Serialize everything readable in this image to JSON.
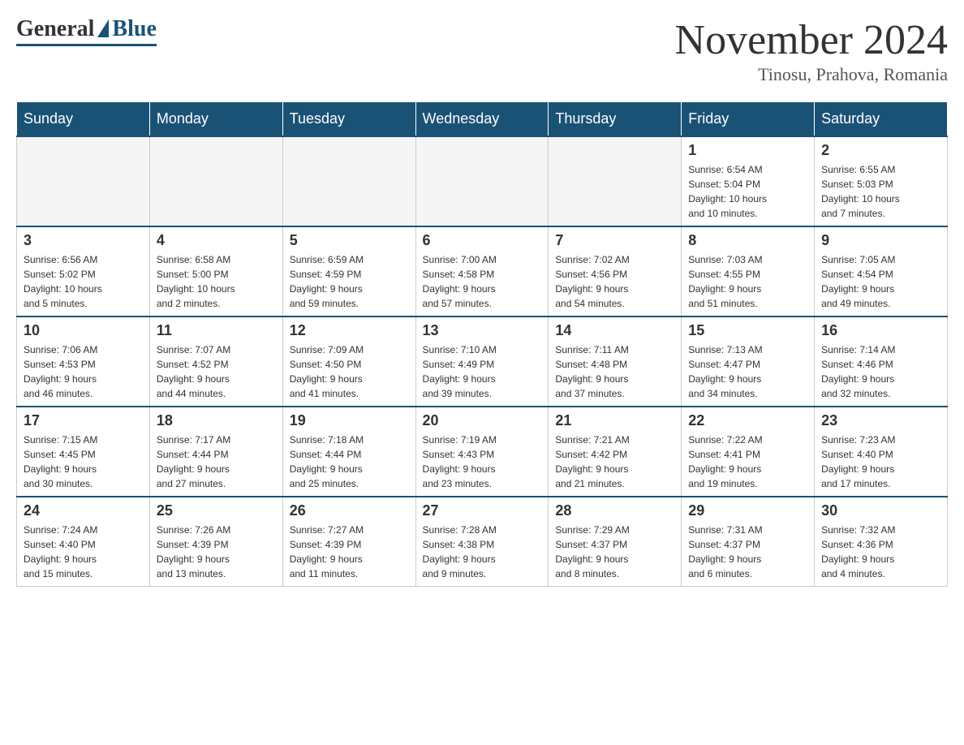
{
  "logo": {
    "general": "General",
    "blue": "Blue"
  },
  "title": {
    "month_year": "November 2024",
    "location": "Tinosu, Prahova, Romania"
  },
  "days_of_week": [
    "Sunday",
    "Monday",
    "Tuesday",
    "Wednesday",
    "Thursday",
    "Friday",
    "Saturday"
  ],
  "weeks": [
    [
      {
        "day": "",
        "info": ""
      },
      {
        "day": "",
        "info": ""
      },
      {
        "day": "",
        "info": ""
      },
      {
        "day": "",
        "info": ""
      },
      {
        "day": "",
        "info": ""
      },
      {
        "day": "1",
        "info": "Sunrise: 6:54 AM\nSunset: 5:04 PM\nDaylight: 10 hours\nand 10 minutes."
      },
      {
        "day": "2",
        "info": "Sunrise: 6:55 AM\nSunset: 5:03 PM\nDaylight: 10 hours\nand 7 minutes."
      }
    ],
    [
      {
        "day": "3",
        "info": "Sunrise: 6:56 AM\nSunset: 5:02 PM\nDaylight: 10 hours\nand 5 minutes."
      },
      {
        "day": "4",
        "info": "Sunrise: 6:58 AM\nSunset: 5:00 PM\nDaylight: 10 hours\nand 2 minutes."
      },
      {
        "day": "5",
        "info": "Sunrise: 6:59 AM\nSunset: 4:59 PM\nDaylight: 9 hours\nand 59 minutes."
      },
      {
        "day": "6",
        "info": "Sunrise: 7:00 AM\nSunset: 4:58 PM\nDaylight: 9 hours\nand 57 minutes."
      },
      {
        "day": "7",
        "info": "Sunrise: 7:02 AM\nSunset: 4:56 PM\nDaylight: 9 hours\nand 54 minutes."
      },
      {
        "day": "8",
        "info": "Sunrise: 7:03 AM\nSunset: 4:55 PM\nDaylight: 9 hours\nand 51 minutes."
      },
      {
        "day": "9",
        "info": "Sunrise: 7:05 AM\nSunset: 4:54 PM\nDaylight: 9 hours\nand 49 minutes."
      }
    ],
    [
      {
        "day": "10",
        "info": "Sunrise: 7:06 AM\nSunset: 4:53 PM\nDaylight: 9 hours\nand 46 minutes."
      },
      {
        "day": "11",
        "info": "Sunrise: 7:07 AM\nSunset: 4:52 PM\nDaylight: 9 hours\nand 44 minutes."
      },
      {
        "day": "12",
        "info": "Sunrise: 7:09 AM\nSunset: 4:50 PM\nDaylight: 9 hours\nand 41 minutes."
      },
      {
        "day": "13",
        "info": "Sunrise: 7:10 AM\nSunset: 4:49 PM\nDaylight: 9 hours\nand 39 minutes."
      },
      {
        "day": "14",
        "info": "Sunrise: 7:11 AM\nSunset: 4:48 PM\nDaylight: 9 hours\nand 37 minutes."
      },
      {
        "day": "15",
        "info": "Sunrise: 7:13 AM\nSunset: 4:47 PM\nDaylight: 9 hours\nand 34 minutes."
      },
      {
        "day": "16",
        "info": "Sunrise: 7:14 AM\nSunset: 4:46 PM\nDaylight: 9 hours\nand 32 minutes."
      }
    ],
    [
      {
        "day": "17",
        "info": "Sunrise: 7:15 AM\nSunset: 4:45 PM\nDaylight: 9 hours\nand 30 minutes."
      },
      {
        "day": "18",
        "info": "Sunrise: 7:17 AM\nSunset: 4:44 PM\nDaylight: 9 hours\nand 27 minutes."
      },
      {
        "day": "19",
        "info": "Sunrise: 7:18 AM\nSunset: 4:44 PM\nDaylight: 9 hours\nand 25 minutes."
      },
      {
        "day": "20",
        "info": "Sunrise: 7:19 AM\nSunset: 4:43 PM\nDaylight: 9 hours\nand 23 minutes."
      },
      {
        "day": "21",
        "info": "Sunrise: 7:21 AM\nSunset: 4:42 PM\nDaylight: 9 hours\nand 21 minutes."
      },
      {
        "day": "22",
        "info": "Sunrise: 7:22 AM\nSunset: 4:41 PM\nDaylight: 9 hours\nand 19 minutes."
      },
      {
        "day": "23",
        "info": "Sunrise: 7:23 AM\nSunset: 4:40 PM\nDaylight: 9 hours\nand 17 minutes."
      }
    ],
    [
      {
        "day": "24",
        "info": "Sunrise: 7:24 AM\nSunset: 4:40 PM\nDaylight: 9 hours\nand 15 minutes."
      },
      {
        "day": "25",
        "info": "Sunrise: 7:26 AM\nSunset: 4:39 PM\nDaylight: 9 hours\nand 13 minutes."
      },
      {
        "day": "26",
        "info": "Sunrise: 7:27 AM\nSunset: 4:39 PM\nDaylight: 9 hours\nand 11 minutes."
      },
      {
        "day": "27",
        "info": "Sunrise: 7:28 AM\nSunset: 4:38 PM\nDaylight: 9 hours\nand 9 minutes."
      },
      {
        "day": "28",
        "info": "Sunrise: 7:29 AM\nSunset: 4:37 PM\nDaylight: 9 hours\nand 8 minutes."
      },
      {
        "day": "29",
        "info": "Sunrise: 7:31 AM\nSunset: 4:37 PM\nDaylight: 9 hours\nand 6 minutes."
      },
      {
        "day": "30",
        "info": "Sunrise: 7:32 AM\nSunset: 4:36 PM\nDaylight: 9 hours\nand 4 minutes."
      }
    ]
  ]
}
